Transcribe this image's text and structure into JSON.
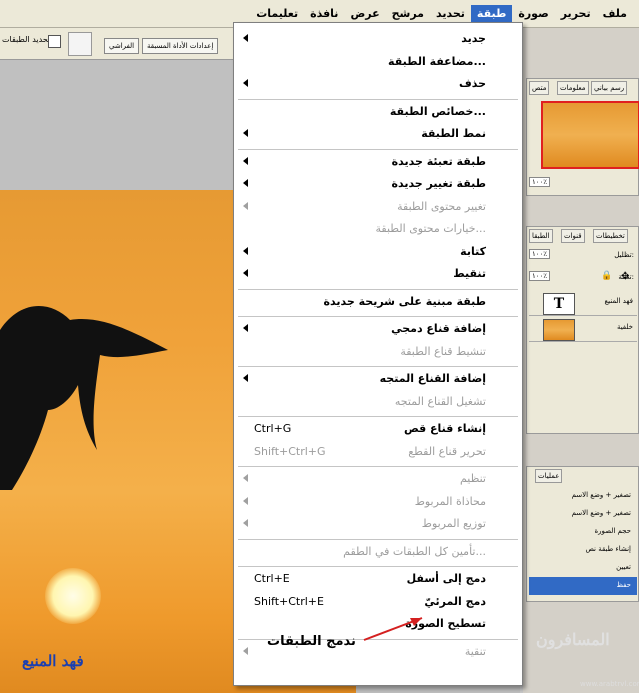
{
  "menubar": {
    "items": [
      {
        "label": "ملف",
        "active": false
      },
      {
        "label": "تحرير",
        "active": false
      },
      {
        "label": "صورة",
        "active": false
      },
      {
        "label": "طبقة",
        "active": true
      },
      {
        "label": "تحديد",
        "active": false
      },
      {
        "label": "مرشح",
        "active": false
      },
      {
        "label": "عرض",
        "active": false
      },
      {
        "label": "نافذة",
        "active": false
      },
      {
        "label": "تعليمات",
        "active": false
      }
    ]
  },
  "options_bar": {
    "checkbox_label": "تحديد الطبقات",
    "tab_1": "إعدادات الأداة المسبقة",
    "tab_2": "الفراشي"
  },
  "layer_menu": {
    "items": [
      {
        "label": "جديد",
        "submenu": true,
        "enabled": true,
        "shortcut": ""
      },
      {
        "label": "مضاعفة الطبقة...",
        "submenu": false,
        "enabled": true,
        "shortcut": ""
      },
      {
        "label": "حذف",
        "submenu": true,
        "enabled": true,
        "shortcut": ""
      },
      {
        "label": "خصائص الطبقة...",
        "submenu": false,
        "enabled": true,
        "shortcut": ""
      },
      {
        "label": "نمط الطبقة",
        "submenu": true,
        "enabled": true,
        "shortcut": ""
      },
      {
        "label": "طبقة تعبئة جديدة",
        "submenu": true,
        "enabled": true,
        "shortcut": ""
      },
      {
        "label": "طبقة تغيير جديدة",
        "submenu": true,
        "enabled": true,
        "shortcut": ""
      },
      {
        "label": "تغيير محتوى الطبقة",
        "submenu": true,
        "enabled": false,
        "shortcut": ""
      },
      {
        "label": "خيارات محتوى الطبقة...",
        "submenu": false,
        "enabled": false,
        "shortcut": ""
      },
      {
        "label": "كتابة",
        "submenu": true,
        "enabled": true,
        "shortcut": ""
      },
      {
        "label": "تنقيط",
        "submenu": true,
        "enabled": true,
        "shortcut": ""
      },
      {
        "label": "طبقة مبنية على شريحة جديدة",
        "submenu": false,
        "enabled": true,
        "shortcut": ""
      },
      {
        "label": "إضافة قناع دمجي",
        "submenu": true,
        "enabled": true,
        "shortcut": ""
      },
      {
        "label": "تنشيط قناع الطبقة",
        "submenu": false,
        "enabled": false,
        "shortcut": ""
      },
      {
        "label": "إضافة القناع المتجه",
        "submenu": true,
        "enabled": true,
        "shortcut": ""
      },
      {
        "label": "تشغيل القناع المتجه",
        "submenu": false,
        "enabled": false,
        "shortcut": ""
      },
      {
        "label": "إنشاء قناع قص",
        "submenu": false,
        "enabled": true,
        "shortcut": "Ctrl+G"
      },
      {
        "label": "تحرير قناع القطع",
        "submenu": false,
        "enabled": false,
        "shortcut": "Shift+Ctrl+G"
      },
      {
        "label": "تنظيم",
        "submenu": true,
        "enabled": false,
        "shortcut": ""
      },
      {
        "label": "محاذاة المربوط",
        "submenu": true,
        "enabled": false,
        "shortcut": ""
      },
      {
        "label": "توزيع المربوط",
        "submenu": true,
        "enabled": false,
        "shortcut": ""
      },
      {
        "label": "تأمين كل الطبقات في الطقم...",
        "submenu": false,
        "enabled": false,
        "shortcut": ""
      },
      {
        "label": "دمج إلى أسفل",
        "submenu": false,
        "enabled": true,
        "shortcut": "Ctrl+E"
      },
      {
        "label": "دمج المرئيّ",
        "submenu": false,
        "enabled": true,
        "shortcut": "Shift+Ctrl+E"
      },
      {
        "label": "تسطيح الصورة",
        "submenu": false,
        "enabled": true,
        "shortcut": ""
      },
      {
        "label": "تنقية",
        "submenu": true,
        "enabled": false,
        "shortcut": ""
      }
    ]
  },
  "annotation": {
    "text": "ندمج الطبقات",
    "color": "#d42020"
  },
  "photo": {
    "watermark": "فهد المنيع"
  },
  "navigator": {
    "tabs": [
      "رسم بياني",
      "معلومات",
      "متص"
    ],
    "zoom": "١٠٠٪"
  },
  "layers": {
    "tabs": [
      "تخطيطات",
      "قنوات",
      "الطبقا"
    ],
    "opacity_label": "تظليل:",
    "opacity": "١٠٠٪",
    "fill_label": "تعبئة:",
    "fill": "١٠٠٪",
    "rows": [
      {
        "name": "فهد المنيع",
        "thumb": "T",
        "kind": "text"
      },
      {
        "name": "خلفية",
        "thumb": "",
        "kind": "image"
      }
    ]
  },
  "actions": {
    "tab": "عمليات",
    "rows": [
      {
        "label": "تصغير + وضع الاسم",
        "selected": false
      },
      {
        "label": "تصغير + وضع الاسم",
        "selected": false
      },
      {
        "label": "حجم الصورة",
        "selected": false
      },
      {
        "label": "إنشاء طبقة نص",
        "selected": false
      },
      {
        "label": "تعيين",
        "selected": false
      },
      {
        "label": "حفظ",
        "selected": true
      }
    ]
  },
  "logo": {
    "text": "المسافرون",
    "sub": "www.arabtrvl.com"
  }
}
